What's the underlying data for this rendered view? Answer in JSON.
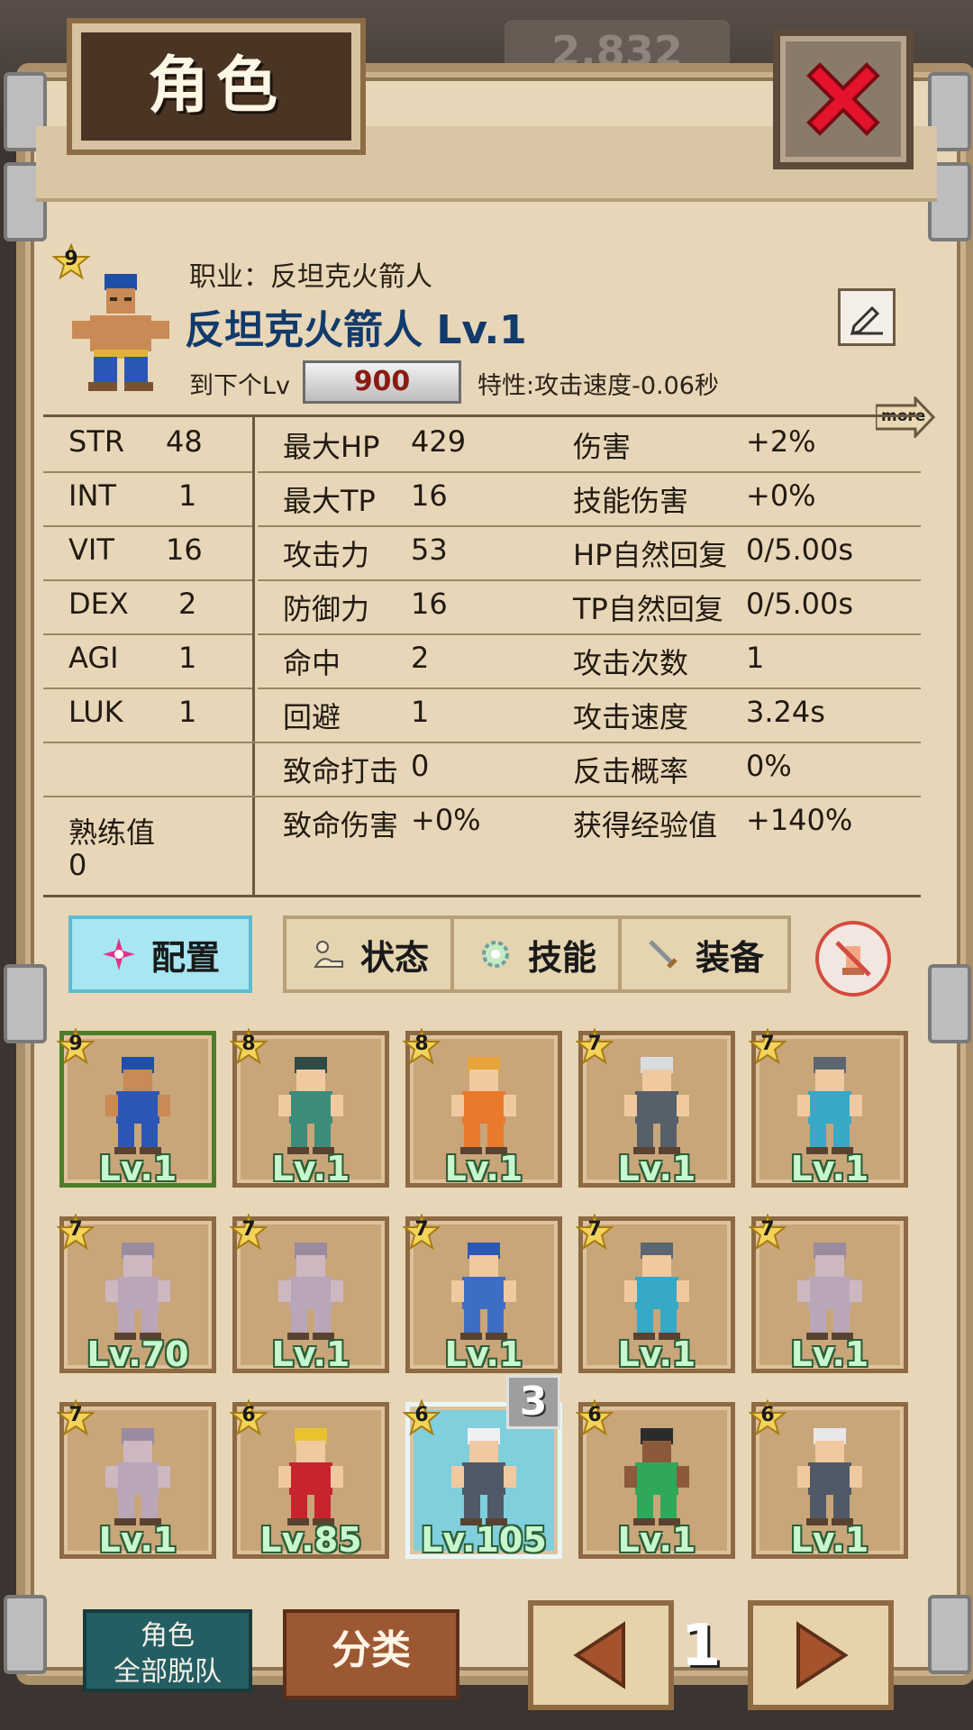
{
  "header": {
    "title": "角色",
    "background_score": "2,832"
  },
  "character": {
    "rank": "9",
    "job_line": "职业：反坦克火箭人",
    "name_line": "反坦克火箭人 Lv.1",
    "exp_label": "到下个Lv",
    "exp_value": "900",
    "trait": "特性:攻击速度-0.06秒",
    "more_label": "more"
  },
  "stats": {
    "base": [
      {
        "label": "STR",
        "value": "48"
      },
      {
        "label": "INT",
        "value": "1"
      },
      {
        "label": "VIT",
        "value": "16"
      },
      {
        "label": "DEX",
        "value": "2"
      },
      {
        "label": "AGI",
        "value": "1"
      },
      {
        "label": "LUK",
        "value": "1"
      }
    ],
    "mastery_label": "熟练值",
    "mastery_value": "0",
    "mid": [
      {
        "label": "最大HP",
        "value": "429"
      },
      {
        "label": "最大TP",
        "value": "16"
      },
      {
        "label": "攻击力",
        "value": "53"
      },
      {
        "label": "防御力",
        "value": "16"
      },
      {
        "label": "命中",
        "value": "2"
      },
      {
        "label": "回避",
        "value": "1"
      },
      {
        "label": "致命打击",
        "value": "0"
      },
      {
        "label": "致命伤害",
        "value": "+0%"
      }
    ],
    "right": [
      {
        "label": "伤害",
        "value": "+2%"
      },
      {
        "label": "技能伤害",
        "value": "+0%"
      },
      {
        "label": "HP自然回复",
        "value": "0/5.00s"
      },
      {
        "label": "TP自然回复",
        "value": "0/5.00s"
      },
      {
        "label": "攻击次数",
        "value": "1"
      },
      {
        "label": "攻击速度",
        "value": "3.24s"
      },
      {
        "label": "反击概率",
        "value": "0%"
      },
      {
        "label": "获得经验值",
        "value": "+140%"
      }
    ]
  },
  "tabs": [
    {
      "label": "配置",
      "icon": "sparkle-icon",
      "active": true
    },
    {
      "label": "状态",
      "icon": "status-icon",
      "active": false
    },
    {
      "label": "技能",
      "icon": "skill-gear-icon",
      "active": false
    },
    {
      "label": "装备",
      "icon": "sword-icon",
      "active": false
    }
  ],
  "roster": [
    {
      "rank": "9",
      "level": "Lv.1",
      "hair": "#1e4fa8",
      "outfit": "#2c56b5",
      "skin": "#c98a55",
      "selected": true
    },
    {
      "rank": "8",
      "level": "Lv.1",
      "hair": "#2f4a45",
      "outfit": "#3c8c7a",
      "skin": "#f1c9a0"
    },
    {
      "rank": "8",
      "level": "Lv.1",
      "hair": "#e6a43a",
      "outfit": "#e97a2b",
      "skin": "#f1c9a0"
    },
    {
      "rank": "7",
      "level": "Lv.1",
      "hair": "#d9dde0",
      "outfit": "#55606a",
      "skin": "#f1c9a0"
    },
    {
      "rank": "7",
      "level": "Lv.1",
      "hair": "#5b6670",
      "outfit": "#37a8c6",
      "skin": "#f1c9a0"
    },
    {
      "rank": "7",
      "level": "Lv.70",
      "hair": "#9b8ba0",
      "outfit": "#b9a6b8",
      "skin": "#cdb8c2"
    },
    {
      "rank": "7",
      "level": "Lv.1",
      "hair": "#9b8ba0",
      "outfit": "#b9a6b8",
      "skin": "#cdb8c2"
    },
    {
      "rank": "7",
      "level": "Lv.1",
      "hair": "#2b58b3",
      "outfit": "#3e6ec4",
      "skin": "#f1c9a0"
    },
    {
      "rank": "7",
      "level": "Lv.1",
      "hair": "#5b6670",
      "outfit": "#37a8c6",
      "skin": "#f1c9a0"
    },
    {
      "rank": "7",
      "level": "Lv.1",
      "hair": "#9b8ba0",
      "outfit": "#b9a6b8",
      "skin": "#cdb8c2"
    },
    {
      "rank": "7",
      "level": "Lv.1",
      "hair": "#9b8ba0",
      "outfit": "#b9a6b8",
      "skin": "#cdb8c2"
    },
    {
      "rank": "6",
      "level": "Lv.85",
      "hair": "#e9c32f",
      "outfit": "#c8242d",
      "skin": "#f1c9a0"
    },
    {
      "rank": "6",
      "level": "Lv.105",
      "hair": "#eef0f2",
      "outfit": "#505a66",
      "skin": "#f1c9a0",
      "highlight": true,
      "order": "3"
    },
    {
      "rank": "6",
      "level": "Lv.1",
      "hair": "#2b2b2b",
      "outfit": "#2fa85a",
      "skin": "#8a5a3a"
    },
    {
      "rank": "6",
      "level": "Lv.1",
      "hair": "#e8e8e8",
      "outfit": "#505a66",
      "skin": "#f1c9a0"
    }
  ],
  "footer": {
    "dismiss_label_line1": "角色",
    "dismiss_label_line2": "全部脱队",
    "sort_label": "分类",
    "page_number": "1"
  },
  "colors": {
    "panel": "#e7d7b8",
    "active_tab": "#a8e6f1",
    "level_text": "#c6f7ce",
    "name_text": "#123a6b",
    "exp_text": "#8b1a12"
  }
}
